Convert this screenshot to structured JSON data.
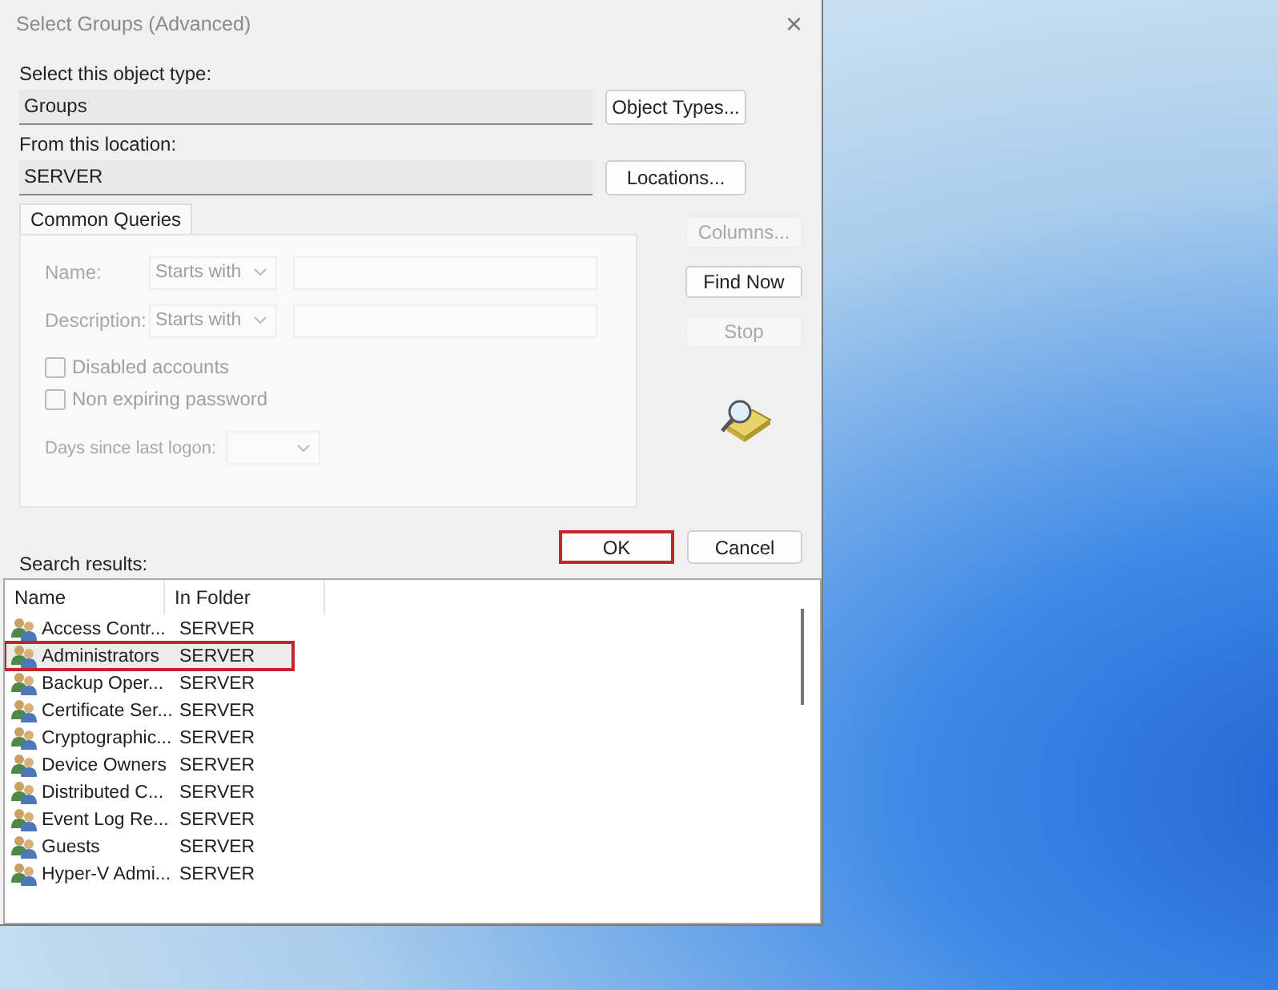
{
  "window": {
    "title": "Select Groups (Advanced)",
    "close": "×"
  },
  "object_type": {
    "label": "Select this object type:",
    "value": "Groups",
    "button": "Object Types..."
  },
  "location": {
    "label": "From this location:",
    "value": "SERVER",
    "button": "Locations..."
  },
  "tabs": [
    {
      "label": "Common Queries",
      "selected": true
    }
  ],
  "queries": {
    "fields": [
      {
        "label": "Name:",
        "operator": "Starts with"
      },
      {
        "label": "Description:",
        "operator": "Starts with"
      }
    ],
    "checkboxes": [
      {
        "label": "Disabled accounts",
        "checked": false
      },
      {
        "label": "Non expiring password",
        "checked": false
      }
    ],
    "days_label": "Days since last logon:"
  },
  "side_buttons": [
    {
      "label": "Columns...",
      "disabled": true
    },
    {
      "label": "Find Now",
      "disabled": false
    },
    {
      "label": "Stop",
      "disabled": true
    }
  ],
  "dialog_buttons": [
    {
      "label": "OK",
      "highlighted": true
    },
    {
      "label": "Cancel",
      "highlighted": false
    }
  ],
  "results": {
    "label": "Search results:",
    "columns": [
      "Name",
      "In Folder"
    ],
    "rows": [
      {
        "name": "Access Contr...",
        "folder": "SERVER",
        "selected": false,
        "highlighted": false
      },
      {
        "name": "Administrators",
        "folder": "SERVER",
        "selected": true,
        "highlighted": true
      },
      {
        "name": "Backup Oper...",
        "folder": "SERVER",
        "selected": false,
        "highlighted": false
      },
      {
        "name": "Certificate Ser...",
        "folder": "SERVER",
        "selected": false,
        "highlighted": false
      },
      {
        "name": "Cryptographic...",
        "folder": "SERVER",
        "selected": false,
        "highlighted": false
      },
      {
        "name": "Device Owners",
        "folder": "SERVER",
        "selected": false,
        "highlighted": false
      },
      {
        "name": "Distributed C...",
        "folder": "SERVER",
        "selected": false,
        "highlighted": false
      },
      {
        "name": "Event Log Re...",
        "folder": "SERVER",
        "selected": false,
        "highlighted": false
      },
      {
        "name": "Guests",
        "folder": "SERVER",
        "selected": false,
        "highlighted": false
      },
      {
        "name": "Hyper-V Admi...",
        "folder": "SERVER",
        "selected": false,
        "highlighted": false
      }
    ]
  }
}
